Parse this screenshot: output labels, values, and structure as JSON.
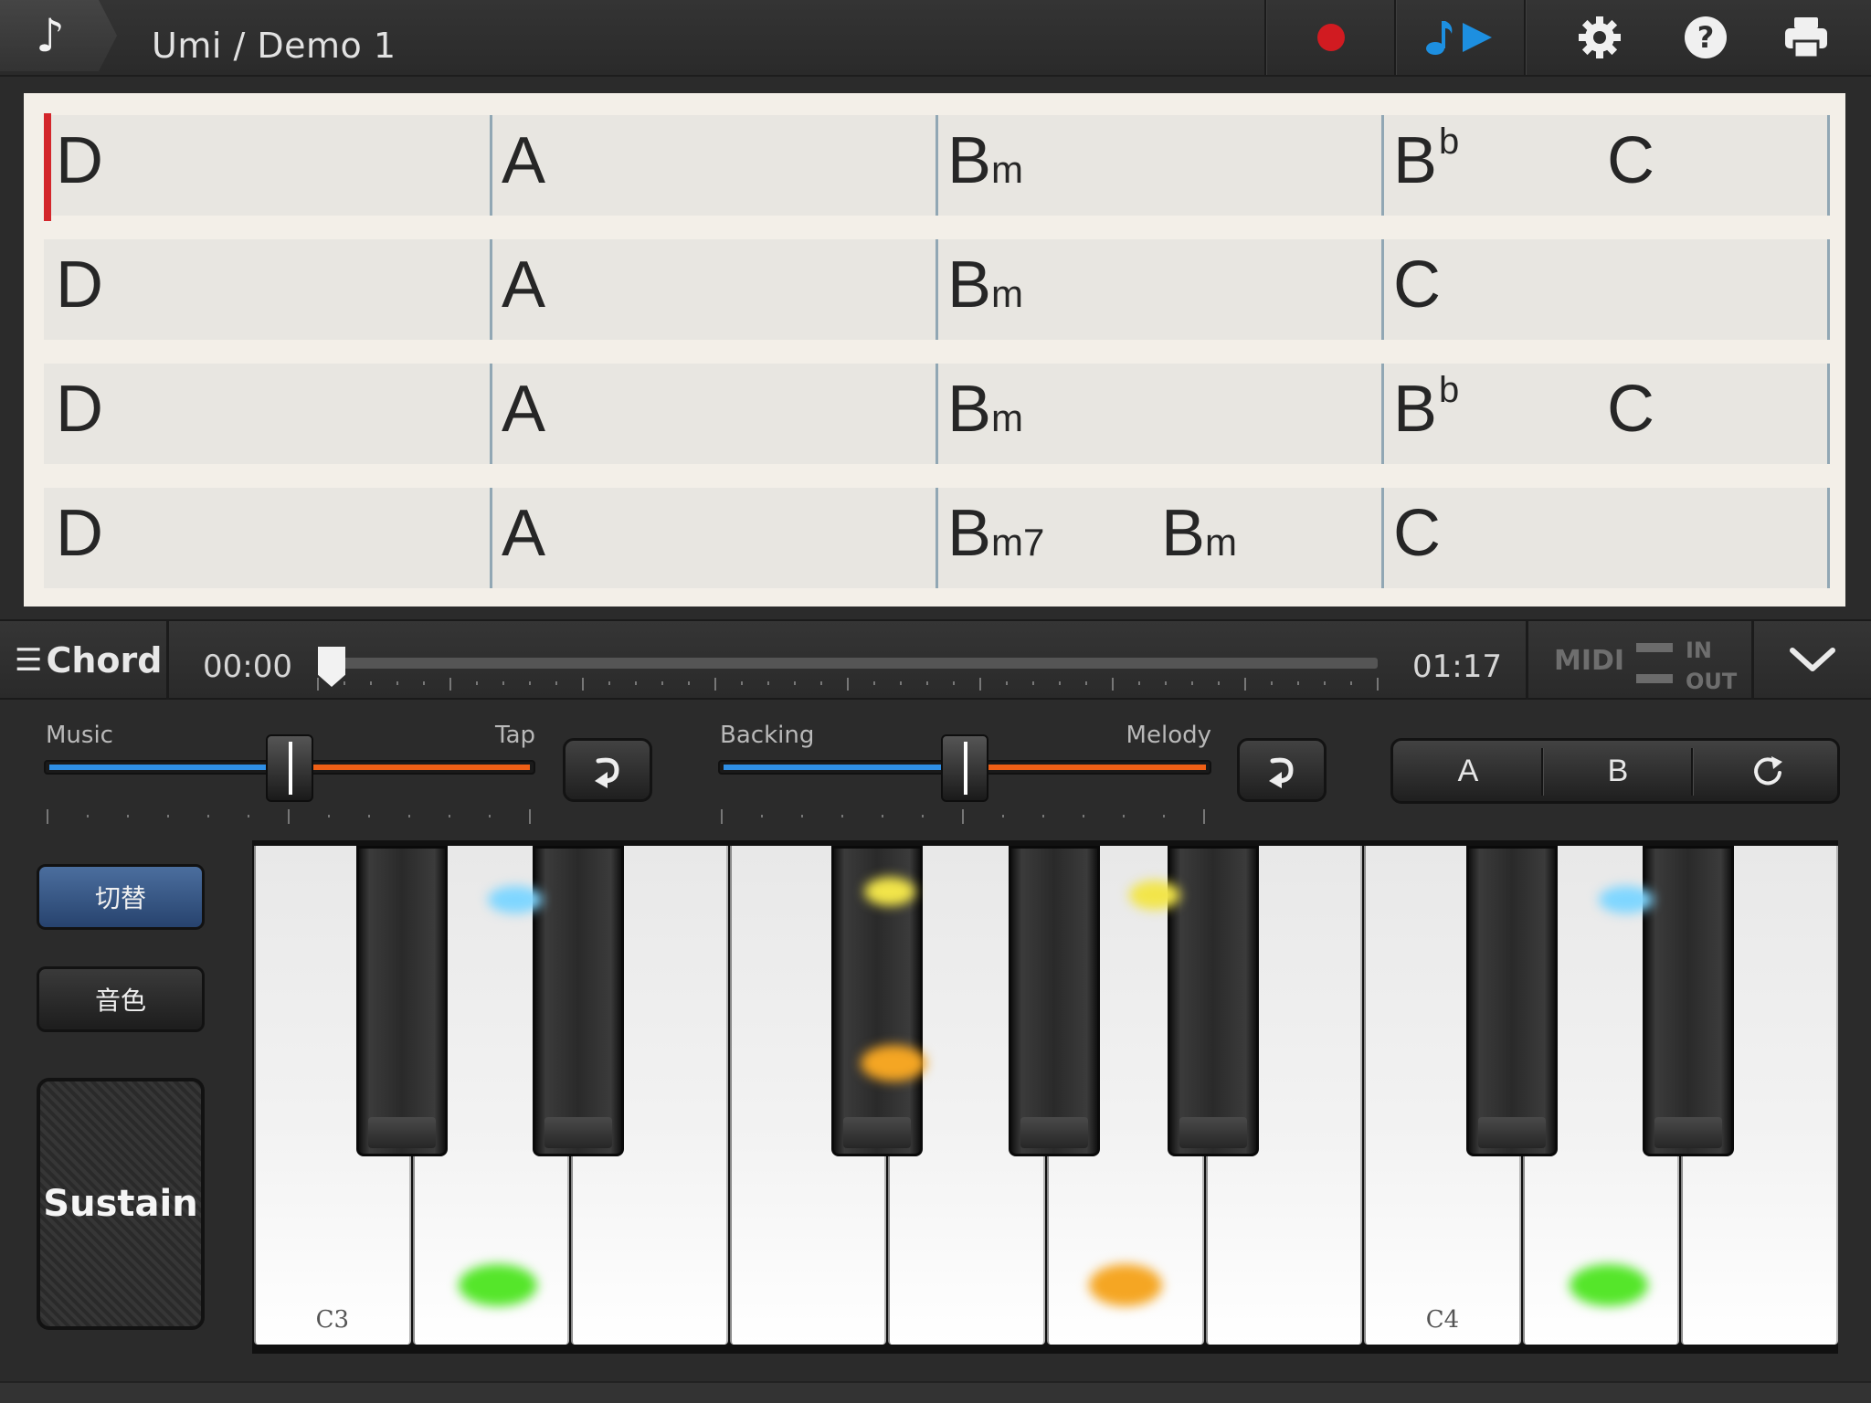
{
  "header": {
    "note_icon": "music-note-icon",
    "title": "Umi / Demo 1",
    "record_icon": "record-icon",
    "play_icon": "note-play-icon",
    "settings_icon": "gear-icon",
    "help_icon": "help-icon",
    "print_icon": "printer-icon",
    "record_color": "#d11b21",
    "play_color": "#1d8fe0"
  },
  "chord_sheet": {
    "rows": [
      {
        "bars": [
          [
            {
              "root": "D"
            }
          ],
          [
            {
              "root": "A"
            }
          ],
          [
            {
              "root": "B",
              "suffix": "m"
            }
          ],
          [
            {
              "root": "B",
              "sup": "b"
            },
            {
              "root": "C"
            }
          ]
        ]
      },
      {
        "bars": [
          [
            {
              "root": "D"
            }
          ],
          [
            {
              "root": "A"
            }
          ],
          [
            {
              "root": "B",
              "suffix": "m"
            }
          ],
          [
            {
              "root": "C"
            }
          ]
        ]
      },
      {
        "bars": [
          [
            {
              "root": "D"
            }
          ],
          [
            {
              "root": "A"
            }
          ],
          [
            {
              "root": "B",
              "suffix": "m"
            }
          ],
          [
            {
              "root": "B",
              "sup": "b"
            },
            {
              "root": "C"
            }
          ]
        ]
      },
      {
        "bars": [
          [
            {
              "root": "D"
            }
          ],
          [
            {
              "root": "A"
            }
          ],
          [
            {
              "root": "B",
              "suffix": "m7"
            },
            {
              "root": "B",
              "suffix": "m"
            }
          ],
          [
            {
              "root": "C"
            }
          ]
        ]
      }
    ]
  },
  "transport": {
    "mode_label": "Chord",
    "time_start": "00:00",
    "time_end": "01:17",
    "position_fraction": 0.0,
    "midi_label": "MIDI",
    "midi_in": "IN",
    "midi_out": "OUT"
  },
  "mixer": {
    "left": {
      "label_left": "Music",
      "label_right": "Tap",
      "balance": 0.5
    },
    "right": {
      "label_left": "Backing",
      "label_right": "Melody",
      "balance": 0.5
    },
    "ab": {
      "a": "A",
      "b": "B",
      "loop_icon": "loop-icon"
    }
  },
  "side": {
    "switch_label": "切替",
    "tone_label": "音色",
    "sustain_label": "Sustain"
  },
  "keyboard": {
    "white_labels": [
      "C3",
      "",
      "",
      "",
      "",
      "",
      "",
      "C4",
      "",
      ""
    ],
    "glow_colors": {
      "blue": "#7fd6ff",
      "green": "#55e62a",
      "yellow": "#f2e54a",
      "orange": "#f5a623"
    }
  }
}
